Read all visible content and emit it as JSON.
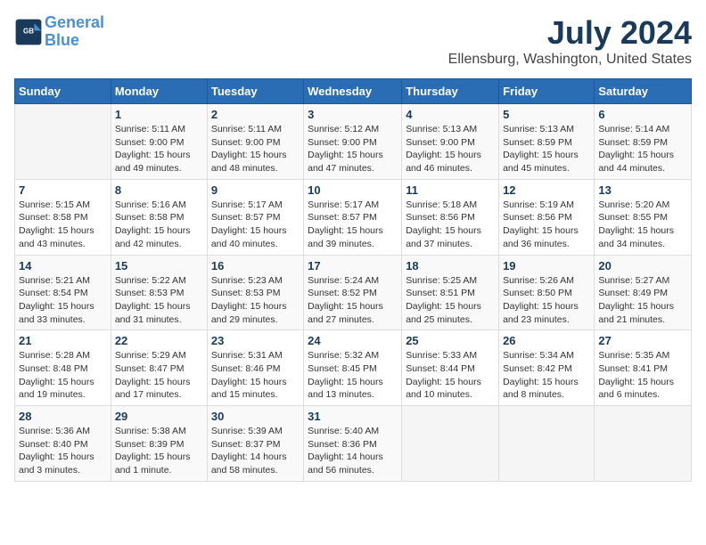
{
  "header": {
    "logo_line1": "General",
    "logo_line2": "Blue",
    "month_year": "July 2024",
    "location": "Ellensburg, Washington, United States"
  },
  "weekdays": [
    "Sunday",
    "Monday",
    "Tuesday",
    "Wednesday",
    "Thursday",
    "Friday",
    "Saturday"
  ],
  "weeks": [
    [
      {
        "day": "",
        "empty": true
      },
      {
        "day": "1",
        "sunrise": "Sunrise: 5:11 AM",
        "sunset": "Sunset: 9:00 PM",
        "daylight": "Daylight: 15 hours and 49 minutes."
      },
      {
        "day": "2",
        "sunrise": "Sunrise: 5:11 AM",
        "sunset": "Sunset: 9:00 PM",
        "daylight": "Daylight: 15 hours and 48 minutes."
      },
      {
        "day": "3",
        "sunrise": "Sunrise: 5:12 AM",
        "sunset": "Sunset: 9:00 PM",
        "daylight": "Daylight: 15 hours and 47 minutes."
      },
      {
        "day": "4",
        "sunrise": "Sunrise: 5:13 AM",
        "sunset": "Sunset: 9:00 PM",
        "daylight": "Daylight: 15 hours and 46 minutes."
      },
      {
        "day": "5",
        "sunrise": "Sunrise: 5:13 AM",
        "sunset": "Sunset: 8:59 PM",
        "daylight": "Daylight: 15 hours and 45 minutes."
      },
      {
        "day": "6",
        "sunrise": "Sunrise: 5:14 AM",
        "sunset": "Sunset: 8:59 PM",
        "daylight": "Daylight: 15 hours and 44 minutes."
      }
    ],
    [
      {
        "day": "7",
        "sunrise": "Sunrise: 5:15 AM",
        "sunset": "Sunset: 8:58 PM",
        "daylight": "Daylight: 15 hours and 43 minutes."
      },
      {
        "day": "8",
        "sunrise": "Sunrise: 5:16 AM",
        "sunset": "Sunset: 8:58 PM",
        "daylight": "Daylight: 15 hours and 42 minutes."
      },
      {
        "day": "9",
        "sunrise": "Sunrise: 5:17 AM",
        "sunset": "Sunset: 8:57 PM",
        "daylight": "Daylight: 15 hours and 40 minutes."
      },
      {
        "day": "10",
        "sunrise": "Sunrise: 5:17 AM",
        "sunset": "Sunset: 8:57 PM",
        "daylight": "Daylight: 15 hours and 39 minutes."
      },
      {
        "day": "11",
        "sunrise": "Sunrise: 5:18 AM",
        "sunset": "Sunset: 8:56 PM",
        "daylight": "Daylight: 15 hours and 37 minutes."
      },
      {
        "day": "12",
        "sunrise": "Sunrise: 5:19 AM",
        "sunset": "Sunset: 8:56 PM",
        "daylight": "Daylight: 15 hours and 36 minutes."
      },
      {
        "day": "13",
        "sunrise": "Sunrise: 5:20 AM",
        "sunset": "Sunset: 8:55 PM",
        "daylight": "Daylight: 15 hours and 34 minutes."
      }
    ],
    [
      {
        "day": "14",
        "sunrise": "Sunrise: 5:21 AM",
        "sunset": "Sunset: 8:54 PM",
        "daylight": "Daylight: 15 hours and 33 minutes."
      },
      {
        "day": "15",
        "sunrise": "Sunrise: 5:22 AM",
        "sunset": "Sunset: 8:53 PM",
        "daylight": "Daylight: 15 hours and 31 minutes."
      },
      {
        "day": "16",
        "sunrise": "Sunrise: 5:23 AM",
        "sunset": "Sunset: 8:53 PM",
        "daylight": "Daylight: 15 hours and 29 minutes."
      },
      {
        "day": "17",
        "sunrise": "Sunrise: 5:24 AM",
        "sunset": "Sunset: 8:52 PM",
        "daylight": "Daylight: 15 hours and 27 minutes."
      },
      {
        "day": "18",
        "sunrise": "Sunrise: 5:25 AM",
        "sunset": "Sunset: 8:51 PM",
        "daylight": "Daylight: 15 hours and 25 minutes."
      },
      {
        "day": "19",
        "sunrise": "Sunrise: 5:26 AM",
        "sunset": "Sunset: 8:50 PM",
        "daylight": "Daylight: 15 hours and 23 minutes."
      },
      {
        "day": "20",
        "sunrise": "Sunrise: 5:27 AM",
        "sunset": "Sunset: 8:49 PM",
        "daylight": "Daylight: 15 hours and 21 minutes."
      }
    ],
    [
      {
        "day": "21",
        "sunrise": "Sunrise: 5:28 AM",
        "sunset": "Sunset: 8:48 PM",
        "daylight": "Daylight: 15 hours and 19 minutes."
      },
      {
        "day": "22",
        "sunrise": "Sunrise: 5:29 AM",
        "sunset": "Sunset: 8:47 PM",
        "daylight": "Daylight: 15 hours and 17 minutes."
      },
      {
        "day": "23",
        "sunrise": "Sunrise: 5:31 AM",
        "sunset": "Sunset: 8:46 PM",
        "daylight": "Daylight: 15 hours and 15 minutes."
      },
      {
        "day": "24",
        "sunrise": "Sunrise: 5:32 AM",
        "sunset": "Sunset: 8:45 PM",
        "daylight": "Daylight: 15 hours and 13 minutes."
      },
      {
        "day": "25",
        "sunrise": "Sunrise: 5:33 AM",
        "sunset": "Sunset: 8:44 PM",
        "daylight": "Daylight: 15 hours and 10 minutes."
      },
      {
        "day": "26",
        "sunrise": "Sunrise: 5:34 AM",
        "sunset": "Sunset: 8:42 PM",
        "daylight": "Daylight: 15 hours and 8 minutes."
      },
      {
        "day": "27",
        "sunrise": "Sunrise: 5:35 AM",
        "sunset": "Sunset: 8:41 PM",
        "daylight": "Daylight: 15 hours and 6 minutes."
      }
    ],
    [
      {
        "day": "28",
        "sunrise": "Sunrise: 5:36 AM",
        "sunset": "Sunset: 8:40 PM",
        "daylight": "Daylight: 15 hours and 3 minutes."
      },
      {
        "day": "29",
        "sunrise": "Sunrise: 5:38 AM",
        "sunset": "Sunset: 8:39 PM",
        "daylight": "Daylight: 15 hours and 1 minute."
      },
      {
        "day": "30",
        "sunrise": "Sunrise: 5:39 AM",
        "sunset": "Sunset: 8:37 PM",
        "daylight": "Daylight: 14 hours and 58 minutes."
      },
      {
        "day": "31",
        "sunrise": "Sunrise: 5:40 AM",
        "sunset": "Sunset: 8:36 PM",
        "daylight": "Daylight: 14 hours and 56 minutes."
      },
      {
        "day": "",
        "empty": true
      },
      {
        "day": "",
        "empty": true
      },
      {
        "day": "",
        "empty": true
      }
    ]
  ]
}
